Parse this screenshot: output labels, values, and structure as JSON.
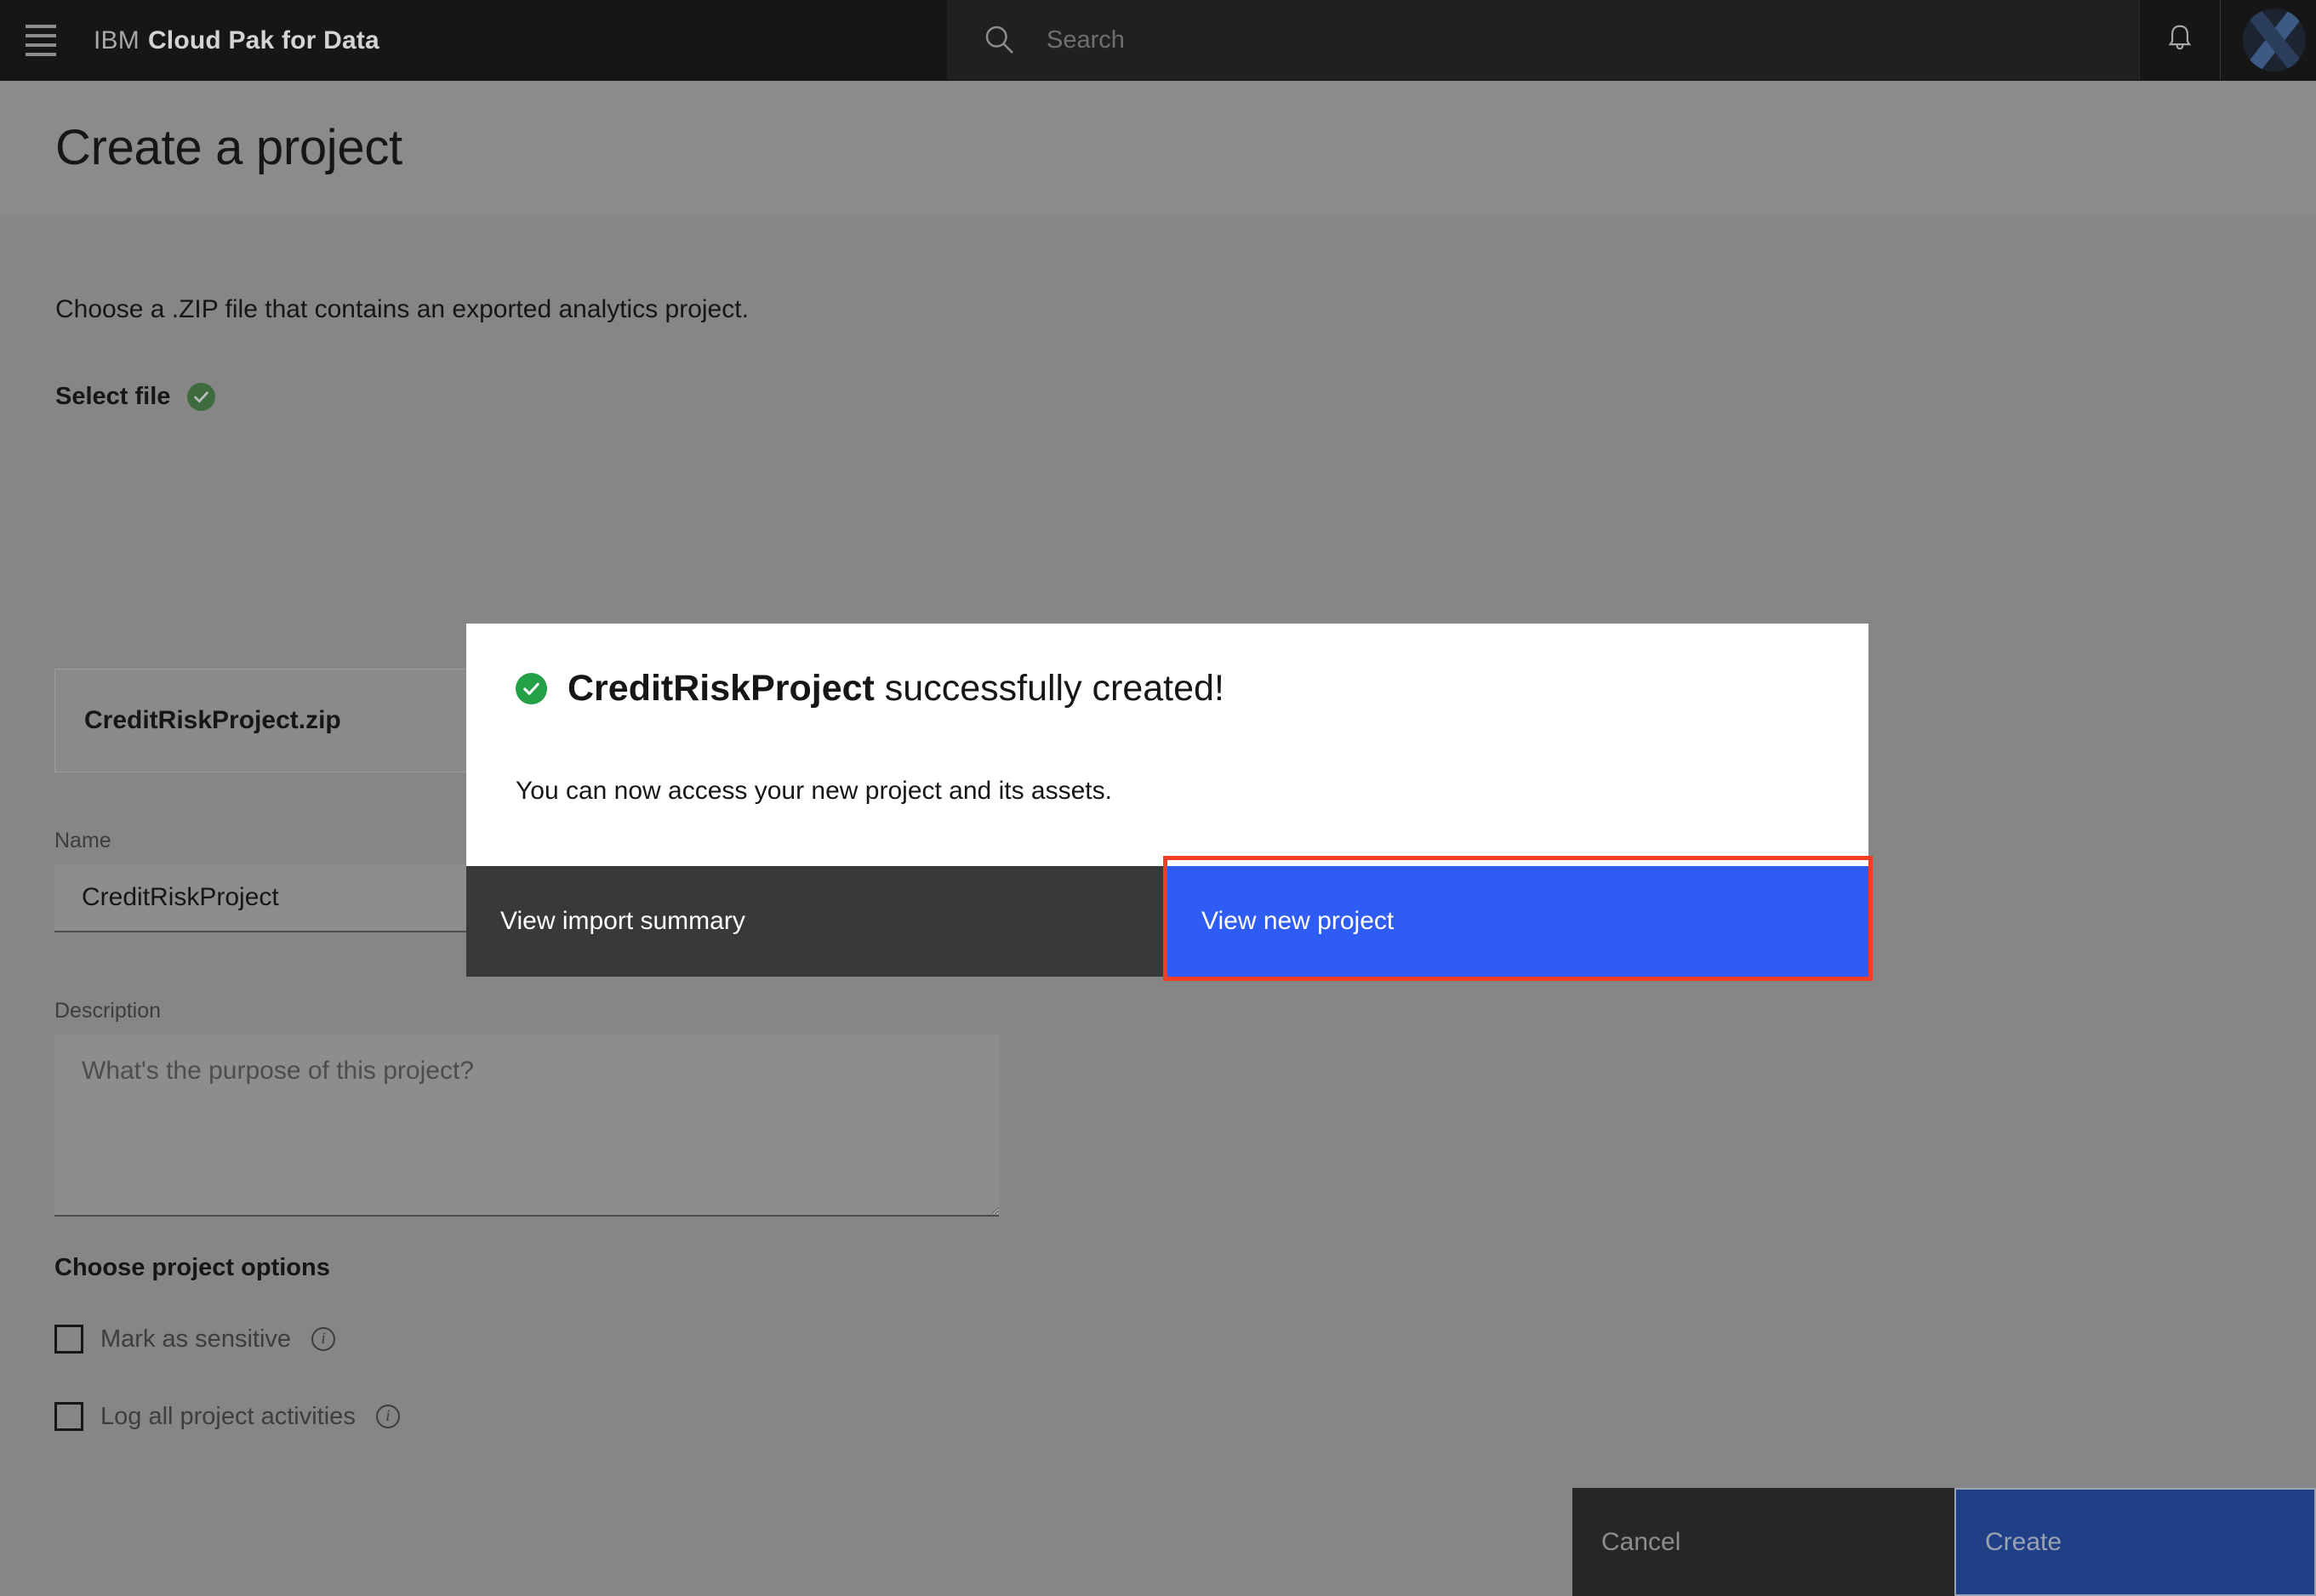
{
  "topbar": {
    "menu_icon": "hamburger-menu-icon",
    "brand_light": "IBM",
    "brand_bold": "Cloud Pak for Data",
    "search_icon": "search-icon",
    "search_placeholder": "Search",
    "search_value": "",
    "notification_icon": "bell-icon",
    "avatar_icon": "user-avatar",
    "background": "#161616"
  },
  "header": {
    "title": "Create a project",
    "background": "#8b8b8b"
  },
  "main": {
    "intro_text": "Choose a .ZIP file that contains an exported analytics project.",
    "select_file_label": "Select file",
    "select_file_status_icon": "check-circle-icon",
    "file_card": {
      "file_name": "CreditRiskProject.zip",
      "remove_icon": "close-circle-icon",
      "remove_icon_color": "#3d56b2"
    },
    "name": {
      "label": "Name",
      "value": "CreditRiskProject",
      "placeholder": ""
    },
    "description": {
      "label": "Description",
      "value": "",
      "placeholder": "What's the purpose of this project?"
    },
    "options_heading": "Choose project options",
    "options": [
      {
        "label": "Mark as sensitive",
        "checked": false,
        "info_icon": "info-icon"
      },
      {
        "label": "Log all project activities",
        "checked": false,
        "info_icon": "info-icon"
      }
    ]
  },
  "footer": {
    "cancel_label": "Cancel",
    "create_label": "Create",
    "create_color": "#1f3f87"
  },
  "modal": {
    "status_icon": "check-circle-icon",
    "status_color": "#24a148",
    "title_strong": "CreditRiskProject",
    "title_rest": " successfully created!",
    "subtitle": "You can now access your new project and its assets.",
    "secondary_button": "View import summary",
    "primary_button": "View new project",
    "primary_color": "#2f5cf5",
    "highlight_color": "#f03f24"
  }
}
